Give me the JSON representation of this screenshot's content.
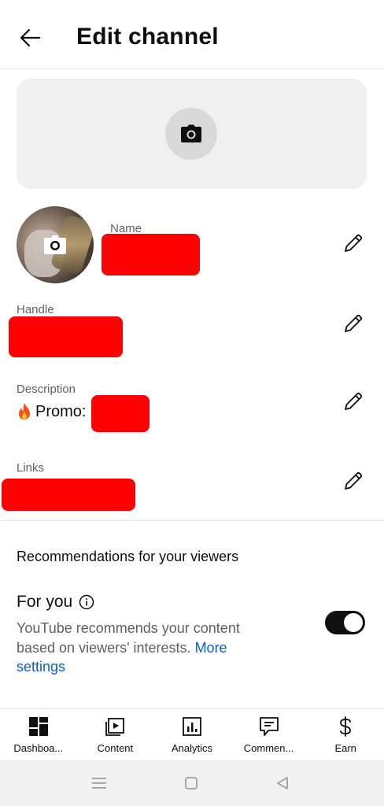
{
  "header": {
    "title": "Edit channel",
    "back_icon": "arrow-left-icon"
  },
  "banner": {
    "camera_icon": "camera-icon"
  },
  "profile": {
    "avatar_camera_icon": "camera-icon",
    "name_label": "Name",
    "name_value_redacted": true
  },
  "handle": {
    "label": "Handle",
    "value_redacted": true
  },
  "description": {
    "label": "Description",
    "emoji": "fire-emoji",
    "prefix": "Promo:",
    "value_redacted": true
  },
  "links": {
    "label": "Links",
    "value_redacted": true
  },
  "recommendations": {
    "section_title": "Recommendations for your viewers",
    "for_you_title": "For you",
    "description": "YouTube recommends your content based on viewers' interests.",
    "more_link": "More settings",
    "toggle_on": true
  },
  "bottom_nav": {
    "items": [
      {
        "label": "Dashboa...",
        "icon": "dashboard-icon"
      },
      {
        "label": "Content",
        "icon": "content-icon"
      },
      {
        "label": "Analytics",
        "icon": "analytics-icon"
      },
      {
        "label": "Commen...",
        "icon": "comments-icon"
      },
      {
        "label": "Earn",
        "icon": "dollar-icon"
      }
    ]
  },
  "colors": {
    "accent_link": "#065fd4",
    "redaction": "#ff0000",
    "toggle_on": "#0f0f0f"
  }
}
